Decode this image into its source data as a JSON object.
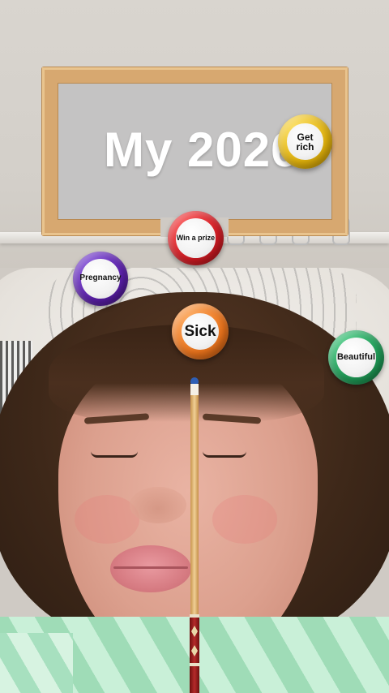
{
  "board": {
    "title": "My 2026"
  },
  "balls": [
    {
      "label": "Get rich",
      "color": "#e0b10c"
    },
    {
      "label": "Win a prize",
      "color": "#d11b23"
    },
    {
      "label": "Pregnancy",
      "color": "#5a1fa8"
    },
    {
      "label": "Sick",
      "color": "#e9731c"
    },
    {
      "label": "Beautiful",
      "color": "#1f9a56"
    }
  ],
  "cue": {
    "tip_color": "#2f5fb5",
    "butt_color": "#9e1f1f"
  }
}
